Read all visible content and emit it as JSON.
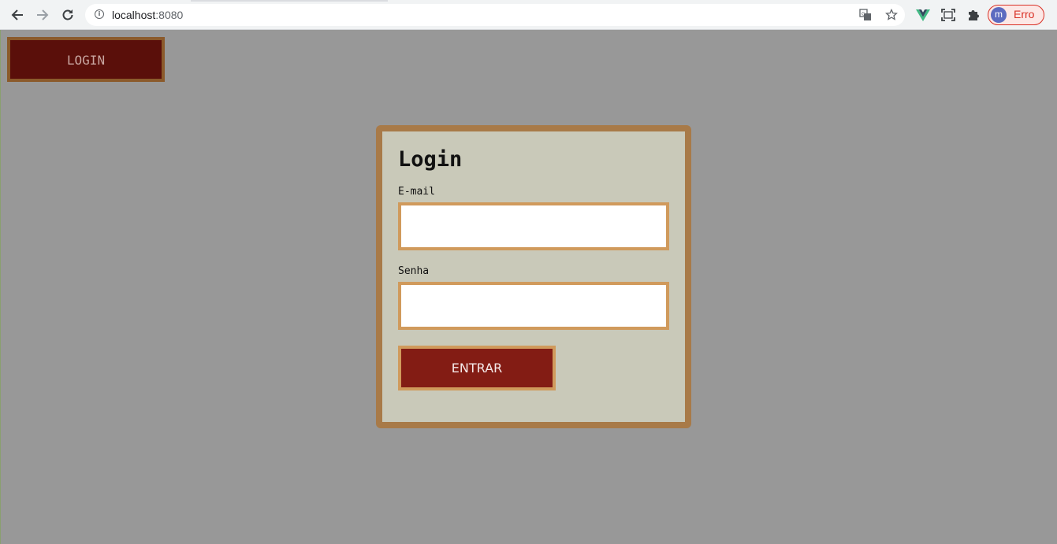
{
  "browser": {
    "url_host": "localhost",
    "url_port": ":8080",
    "profile_initial": "m",
    "profile_label": "Erro",
    "icons": [
      "back-arrow-icon",
      "forward-arrow-icon",
      "reload-icon",
      "site-info-icon",
      "translate-icon",
      "bookmark-star-icon",
      "vue-devtools-icon",
      "screen-capture-icon",
      "extensions-puzzle-icon",
      "profile-avatar"
    ]
  },
  "nav": {
    "login_label": "LOGIN"
  },
  "form": {
    "title": "Login",
    "email_label": "E-mail",
    "email_value": "",
    "password_label": "Senha",
    "password_value": "",
    "submit_label": "ENTRAR"
  },
  "colors": {
    "page_background": "#989898",
    "card_background": "#c9c9b9",
    "card_border": "#a87a48",
    "input_border": "#d09a5c",
    "submit_background": "#831c14",
    "nav_button_background": "#5a0f0a",
    "nav_button_border": "#8b5a2b"
  }
}
